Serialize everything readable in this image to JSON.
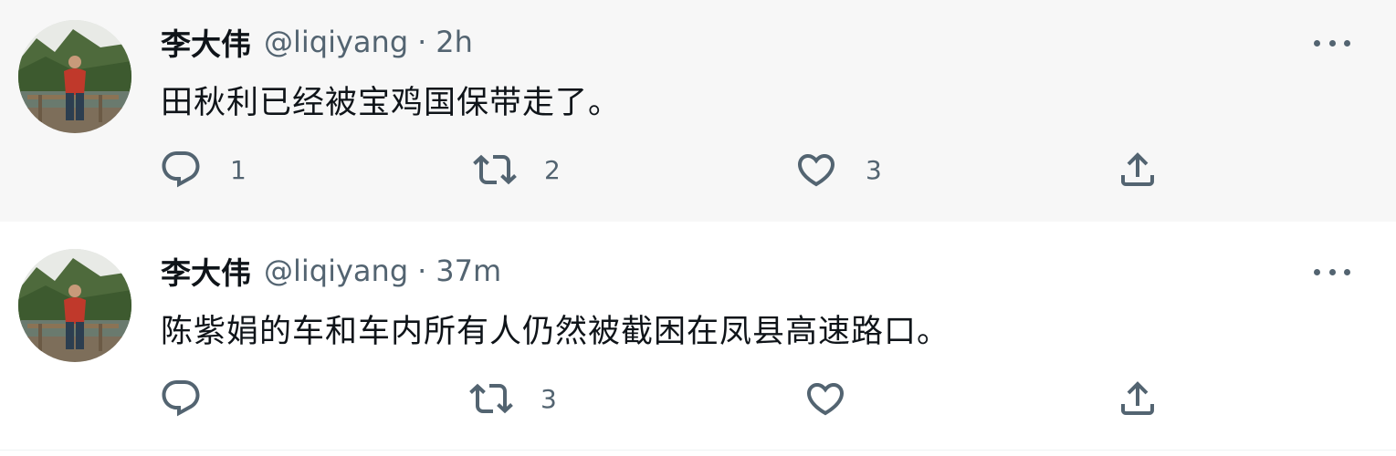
{
  "tweets": [
    {
      "name": "李大伟",
      "handle": "@liqiyang",
      "separator": "·",
      "time": "2h",
      "text": "田秋利已经被宝鸡国保带走了。",
      "reply_count": "1",
      "retweet_count": "2",
      "like_count": "3",
      "share_count": ""
    },
    {
      "name": "李大伟",
      "handle": "@liqiyang",
      "separator": "·",
      "time": "37m",
      "text": "陈紫娟的车和车内所有人仍然被截困在凤县高速路口。",
      "reply_count": "",
      "retweet_count": "3",
      "like_count": "",
      "share_count": ""
    }
  ],
  "icons": {
    "reply": "reply-icon",
    "retweet": "retweet-icon",
    "like": "heart-icon",
    "share": "share-icon",
    "more": "more-icon"
  },
  "colors": {
    "text_primary": "#0f1419",
    "text_secondary": "#536471",
    "highlight_background": "#f7f7f7",
    "thread_line": "#cfd9de"
  }
}
